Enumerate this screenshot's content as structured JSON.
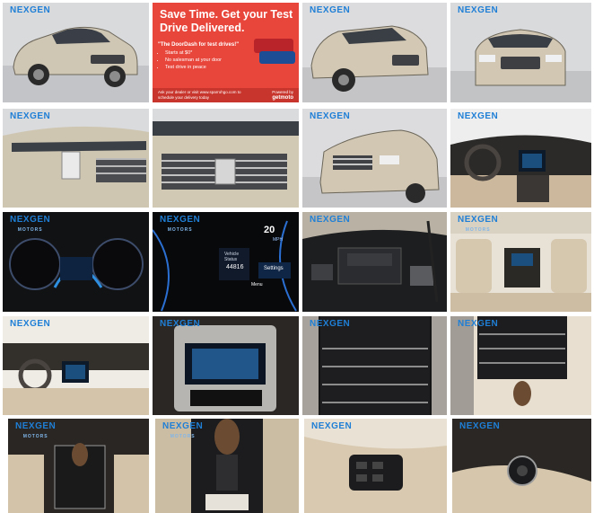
{
  "gallery": {
    "logo": {
      "prefix": "NE",
      "x": "X",
      "suffix": "GEN",
      "sub": "MOTORS"
    },
    "ad": {
      "headline": "Save Time. Get your Test Drive Delivered.",
      "quote": "\"The DoorDash for test drives!\"",
      "bullets": [
        "Starts at $0*",
        "No salesman at your door",
        "Test drive in peace"
      ],
      "cta": "Ask your dealer or visit www.sparrohgo.com to schedule your delivery today",
      "powered_by": "Powered by",
      "brand": "getmoto"
    },
    "cluster_text": {
      "speed": "20",
      "unit": "MPH",
      "odometer": "44816",
      "settings": "Settings",
      "menu": "Menu",
      "vehicle_status": "Vehicle Status"
    },
    "tiles": [
      {
        "name": "photo-exterior-front-left",
        "logo": true
      },
      {
        "name": "ad-test-drive",
        "logo": false
      },
      {
        "name": "photo-exterior-front-quarter",
        "logo": true
      },
      {
        "name": "photo-exterior-front",
        "logo": true
      },
      {
        "name": "photo-headlight-left",
        "logo": true
      },
      {
        "name": "photo-grille-closeup",
        "logo": true
      },
      {
        "name": "photo-front-right-quarter",
        "logo": true
      },
      {
        "name": "photo-dashboard-wide",
        "logo": true
      },
      {
        "name": "photo-gauge-cluster",
        "logo": true
      },
      {
        "name": "photo-cluster-display",
        "logo": true
      },
      {
        "name": "photo-engine-bay",
        "logo": true
      },
      {
        "name": "photo-rear-seats",
        "logo": true
      },
      {
        "name": "photo-interior-front",
        "logo": true
      },
      {
        "name": "photo-infotainment",
        "logo": true
      },
      {
        "name": "photo-climate-controls",
        "logo": true
      },
      {
        "name": "photo-center-console",
        "logo": true
      },
      {
        "name": "photo-shifter",
        "logo": true
      },
      {
        "name": "photo-shifter-closeup",
        "logo": true
      },
      {
        "name": "photo-door-panel",
        "logo": true
      },
      {
        "name": "photo-headlight-switch",
        "logo": true
      }
    ]
  }
}
